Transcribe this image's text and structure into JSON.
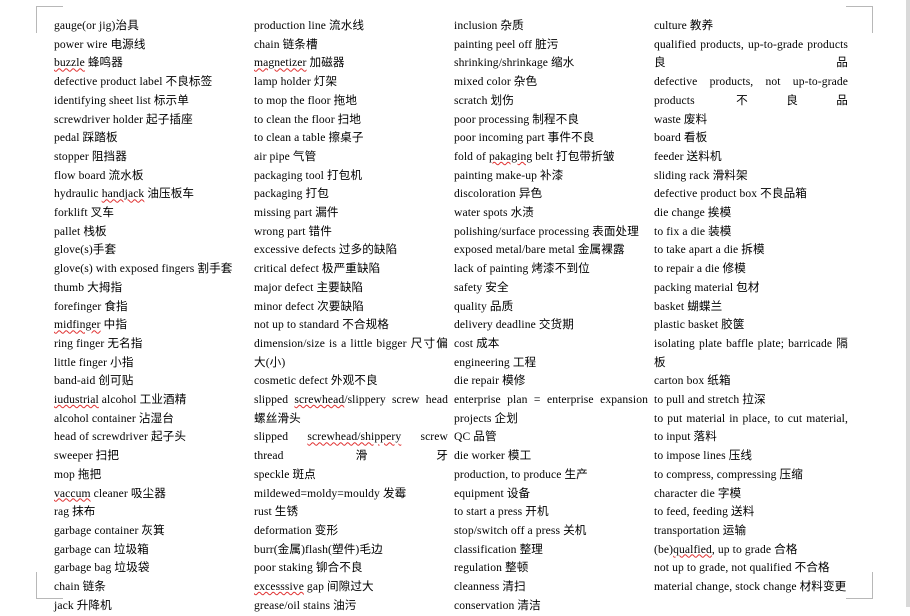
{
  "document": {
    "type": "glossary",
    "title": "Factory English-Chinese Glossary",
    "page_background": "#ffffff",
    "text_color": "#000000",
    "spellcheck_underline_color": "#e03030",
    "margin_mark_color": "#b8b8b8"
  },
  "columns": [
    {
      "name": "column-1",
      "entries": [
        {
          "text": "gauge(or jig)治具"
        },
        {
          "text": "power wire 电源线"
        },
        {
          "text": "buzzle 蜂鸣器",
          "misspelled": "buzzle"
        },
        {
          "text": "defective product label 不良标签"
        },
        {
          "text": "identifying sheet list 标示单"
        },
        {
          "text": "screwdriver holder 起子插座"
        },
        {
          "text": "pedal 踩踏板"
        },
        {
          "text": "stopper 阻挡器"
        },
        {
          "text": "flow board 流水板"
        },
        {
          "text": "hydraulic handjack 油压板车",
          "misspelled": "handjack"
        },
        {
          "text": "forklift 叉车"
        },
        {
          "text": "pallet 栈板"
        },
        {
          "text": "glove(s)手套"
        },
        {
          "text": "glove(s) with exposed fingers 割手套"
        },
        {
          "text": "thumb 大拇指"
        },
        {
          "text": "forefinger 食指"
        },
        {
          "text": "midfinger 中指",
          "misspelled": "midfinger"
        },
        {
          "text": "ring finger 无名指"
        },
        {
          "text": "little finger 小指"
        },
        {
          "text": "band-aid 创可贴"
        },
        {
          "text": "iudustrial alcohol 工业酒精",
          "misspelled": "iudustrial"
        },
        {
          "text": "alcohol container 沾湿台"
        },
        {
          "text": "head of screwdriver 起子头"
        },
        {
          "text": "sweeper 扫把"
        },
        {
          "text": "mop 拖把"
        },
        {
          "text": "vaccum cleaner 吸尘器",
          "misspelled": "vaccum"
        },
        {
          "text": "rag  抹布"
        },
        {
          "text": "garbage container 灰箕"
        },
        {
          "text": "garbage can 垃圾箱"
        },
        {
          "text": "garbage bag 垃圾袋"
        },
        {
          "text": "chain 链条"
        },
        {
          "text": "jack 升降机"
        }
      ]
    },
    {
      "name": "column-2",
      "entries": [
        {
          "text": "production line 流水线"
        },
        {
          "text": "chain 链条槽"
        },
        {
          "text": "magnetizer 加磁器",
          "misspelled": "magnetizer"
        },
        {
          "text": "lamp holder 灯架"
        },
        {
          "text": "to mop the floor 拖地"
        },
        {
          "text": "to clean the floor 扫地"
        },
        {
          "text": "to clean a table 擦桌子"
        },
        {
          "text": "air pipe 气管"
        },
        {
          "text": "packaging tool 打包机"
        },
        {
          "text": "packaging 打包"
        },
        {
          "text": "missing part 漏件"
        },
        {
          "text": "wrong part 错件"
        },
        {
          "text": "excessive defects 过多的缺陷"
        },
        {
          "text": "critical defect 极严重缺陷"
        },
        {
          "text": "major defect 主要缺陷"
        },
        {
          "text": "minor defect 次要缺陷"
        },
        {
          "text": "not up to standard 不合规格"
        },
        {
          "text": "dimension/size is a little bigger 尺寸偏大(小)",
          "wrap": true
        },
        {
          "text": "cosmetic defect 外观不良"
        },
        {
          "text": "slipped screwhead/slippery screw head 螺丝滑头",
          "misspelled": "screwhead",
          "wrap": true
        },
        {
          "text": "slipped screwhead/shippery screw thread 滑牙",
          "misspelled": "screwhead/shippery",
          "wrap": true,
          "loose": true
        },
        {
          "text": "speckle 斑点"
        },
        {
          "text": "mildewed=moldy=mouldy 发霉"
        },
        {
          "text": "rust 生锈"
        },
        {
          "text": "deformation 变形"
        },
        {
          "text": "burr(金属)flash(塑件)毛边"
        },
        {
          "text": "poor staking 铆合不良"
        },
        {
          "text": "excesssive gap 间隙过大",
          "misspelled": "excesssive"
        },
        {
          "text": "grease/oil stains 油污"
        }
      ]
    },
    {
      "name": "column-3",
      "entries": [
        {
          "text": "inclusion 杂质"
        },
        {
          "text": "painting peel off 脏污"
        },
        {
          "text": "shrinking/shrinkage 缩水"
        },
        {
          "text": "mixed color 杂色"
        },
        {
          "text": "scratch 划伤"
        },
        {
          "text": "poor processing  制程不良"
        },
        {
          "text": "poor incoming part 事件不良"
        },
        {
          "text": "fold of pakaging belt 打包带折皱",
          "misspelled": "pakaging"
        },
        {
          "text": "painting make-up 补漆"
        },
        {
          "text": "discoloration 异色"
        },
        {
          "text": "water spots 水渍"
        },
        {
          "text": "polishing/surface processing 表面处理"
        },
        {
          "text": "exposed metal/bare metal 金属裸露"
        },
        {
          "text": "lack of painting 烤漆不到位"
        },
        {
          "text": "safety 安全"
        },
        {
          "text": "quality 品质"
        },
        {
          "text": "delivery deadline 交货期"
        },
        {
          "text": "cost 成本"
        },
        {
          "text": "engineering 工程"
        },
        {
          "text": "die repair 模修"
        },
        {
          "text": "enterprise plan = enterprise expansion projects 企划",
          "wrap": true
        },
        {
          "text": "QC 品管"
        },
        {
          "text": "die worker 模工"
        },
        {
          "text": "production, to produce 生产"
        },
        {
          "text": "equipment 设备"
        },
        {
          "text": "to start a press 开机"
        },
        {
          "text": "stop/switch off a press 关机"
        },
        {
          "text": "classification 整理"
        },
        {
          "text": "regulation 整顿"
        },
        {
          "text": "cleanness 清扫"
        },
        {
          "text": "conservation 清洁"
        }
      ]
    },
    {
      "name": "column-4",
      "entries": [
        {
          "text": "culture 教养"
        },
        {
          "text": "qualified     products,    up-to-grade products 良品",
          "wrap": true,
          "loose": true
        },
        {
          "text": "defective  products,  not  up-to-grade products 不良品",
          "wrap": true,
          "loose": true
        },
        {
          "text": "waste 废料"
        },
        {
          "text": "board 看板"
        },
        {
          "text": "feeder 送料机"
        },
        {
          "text": "sliding rack 滑料架"
        },
        {
          "text": "defective product box 不良品箱"
        },
        {
          "text": "die change  挨模"
        },
        {
          "text": "to fix a die 装模"
        },
        {
          "text": "to take apart a die 拆模"
        },
        {
          "text": "to repair a die 修模"
        },
        {
          "text": "packing material 包材"
        },
        {
          "text": "basket 蝴蝶兰"
        },
        {
          "text": "plastic basket 胶箧"
        },
        {
          "text": "isolating plate baffle plate; barricade 隔板",
          "wrap": true
        },
        {
          "text": "carton box 纸箱"
        },
        {
          "text": "to pull and stretch 拉深"
        },
        {
          "text": "to put material in place, to cut material, to input 落料",
          "wrap": true
        },
        {
          "text": "to impose lines 压线"
        },
        {
          "text": "to compress, compressing 压缩"
        },
        {
          "text": "character die 字模"
        },
        {
          "text": "to feed, feeding 送料"
        },
        {
          "text": "transportation 运输"
        },
        {
          "text": "(be)qualfied, up to grade 合格",
          "misspelled": "qualfied"
        },
        {
          "text": "not up to grade, not qualified 不合格"
        },
        {
          "text": "material change, stock change 材料变更",
          "wrap": true
        }
      ]
    }
  ]
}
